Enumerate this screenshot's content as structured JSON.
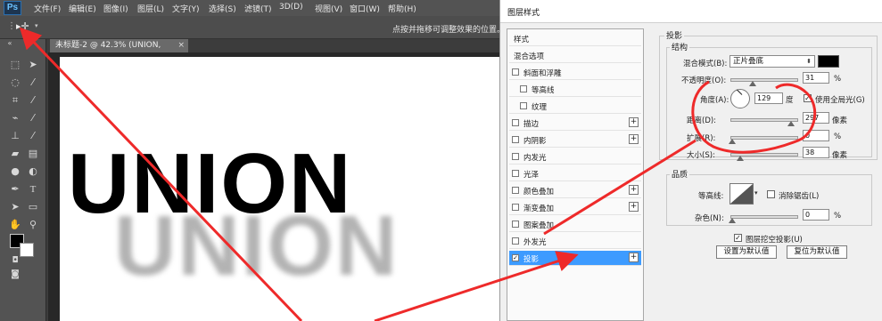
{
  "app": {
    "logo": "Ps",
    "menu": [
      "文件(F)",
      "编辑(E)",
      "图像(I)",
      "图层(L)",
      "文字(Y)",
      "选择(S)",
      "滤镜(T)",
      "3D(D)",
      "视图(V)",
      "窗口(W)",
      "帮助(H)"
    ]
  },
  "options_bar": {
    "hint": "点按并拖移可调整效果的位置。"
  },
  "document": {
    "tab_title": "未标题-2 @ 42.3% (UNION, RGB/8) *",
    "close": "×",
    "text": "UNION",
    "shadow_text": "UNION"
  },
  "dialog": {
    "title": "图层样式",
    "styles": [
      {
        "label": "样式",
        "checkbox": false,
        "plus": false
      },
      {
        "label": "混合选项",
        "checkbox": false,
        "plus": false
      },
      {
        "label": "斜面和浮雕",
        "checkbox": true,
        "plus": false
      },
      {
        "label": "等高线",
        "checkbox": true,
        "plus": false,
        "indent": true
      },
      {
        "label": "纹理",
        "checkbox": true,
        "plus": false,
        "indent": true
      },
      {
        "label": "描边",
        "checkbox": true,
        "plus": true
      },
      {
        "label": "内阴影",
        "checkbox": true,
        "plus": true
      },
      {
        "label": "内发光",
        "checkbox": true,
        "plus": false
      },
      {
        "label": "光泽",
        "checkbox": true,
        "plus": false
      },
      {
        "label": "颜色叠加",
        "checkbox": true,
        "plus": true
      },
      {
        "label": "渐变叠加",
        "checkbox": true,
        "plus": true
      },
      {
        "label": "图案叠加",
        "checkbox": true,
        "plus": false
      },
      {
        "label": "外发光",
        "checkbox": true,
        "plus": false
      },
      {
        "label": "投影",
        "checkbox": true,
        "checked": true,
        "plus": true,
        "active": true
      }
    ],
    "drop_shadow": {
      "section": "投影",
      "structure": "结构",
      "blend_mode_label": "混合模式(B):",
      "blend_mode_value": "正片叠底",
      "shadow_color": "#000000",
      "opacity_label": "不透明度(O):",
      "opacity_value": "31",
      "percent": "%",
      "angle_label": "角度(A):",
      "angle_value": "129",
      "degree": "度",
      "global_light_label": "使用全局光(G)",
      "global_light_check": "✓",
      "distance_label": "距离(D):",
      "distance_value": "297",
      "pixels": "像素",
      "spread_label": "扩展(R):",
      "spread_value": "0",
      "size_label": "大小(S):",
      "size_value": "38",
      "quality": "品质",
      "contour_label": "等高线:",
      "antialias_label": "消除锯齿(L)",
      "noise_label": "杂色(N):",
      "noise_value": "0",
      "knockout_label": "图层挖空投影(U)",
      "knockout_check": "✓",
      "make_default": "设置为默认值",
      "reset_default": "复位为默认值"
    }
  }
}
